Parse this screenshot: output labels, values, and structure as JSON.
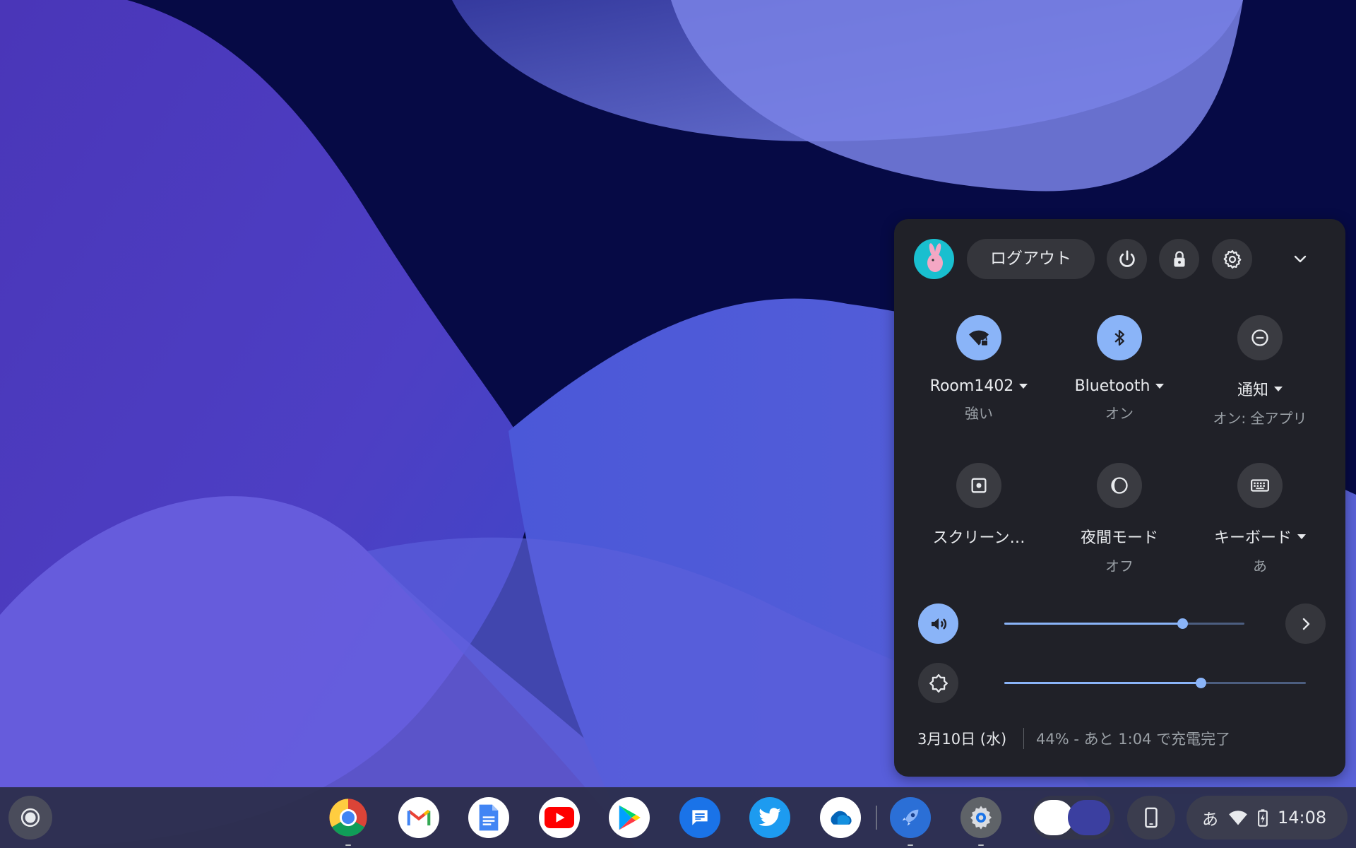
{
  "quick_settings": {
    "header": {
      "logout_label": "ログアウト",
      "avatar_icon": "rabbit-avatar-icon",
      "power_icon": "power-icon",
      "lock_icon": "lock-icon",
      "settings_icon": "gear-icon",
      "collapse_icon": "chevron-down-icon"
    },
    "tiles": [
      {
        "label": "Room1402",
        "sub": "強い",
        "icon": "wifi-lock-icon",
        "on": true
      },
      {
        "label": "Bluetooth",
        "sub": "オン",
        "icon": "bluetooth-icon",
        "on": true
      },
      {
        "label": "通知",
        "sub": "オン: 全アプリ",
        "icon": "do-not-disturb-icon",
        "on": false
      },
      {
        "label": "スクリーン…",
        "sub": "",
        "icon": "screen-capture-icon",
        "on": false
      },
      {
        "label": "夜間モード",
        "sub": "オフ",
        "icon": "night-light-icon",
        "on": false
      },
      {
        "label": "キーボード",
        "sub": "あ",
        "icon": "keyboard-icon",
        "on": false
      }
    ],
    "volume": {
      "icon": "volume-icon",
      "level": 0.74
    },
    "brightness": {
      "icon": "brightness-icon",
      "level": 0.65
    },
    "footer": {
      "date": "3月10日 (水)",
      "battery": "44% - あと 1:04 で充電完了"
    }
  },
  "shelf": {
    "apps": [
      "Chrome",
      "Gmail",
      "Google ドキュメント",
      "YouTube",
      "Google Play ストア",
      "Messages",
      "Twitter",
      "OneDrive",
      "Launch",
      "設定"
    ],
    "status": {
      "ime": "あ",
      "time": "14:08"
    }
  },
  "colors": {
    "accent": "#8ab4f8",
    "panel": "#202128",
    "wallpaper": "#060a45"
  }
}
